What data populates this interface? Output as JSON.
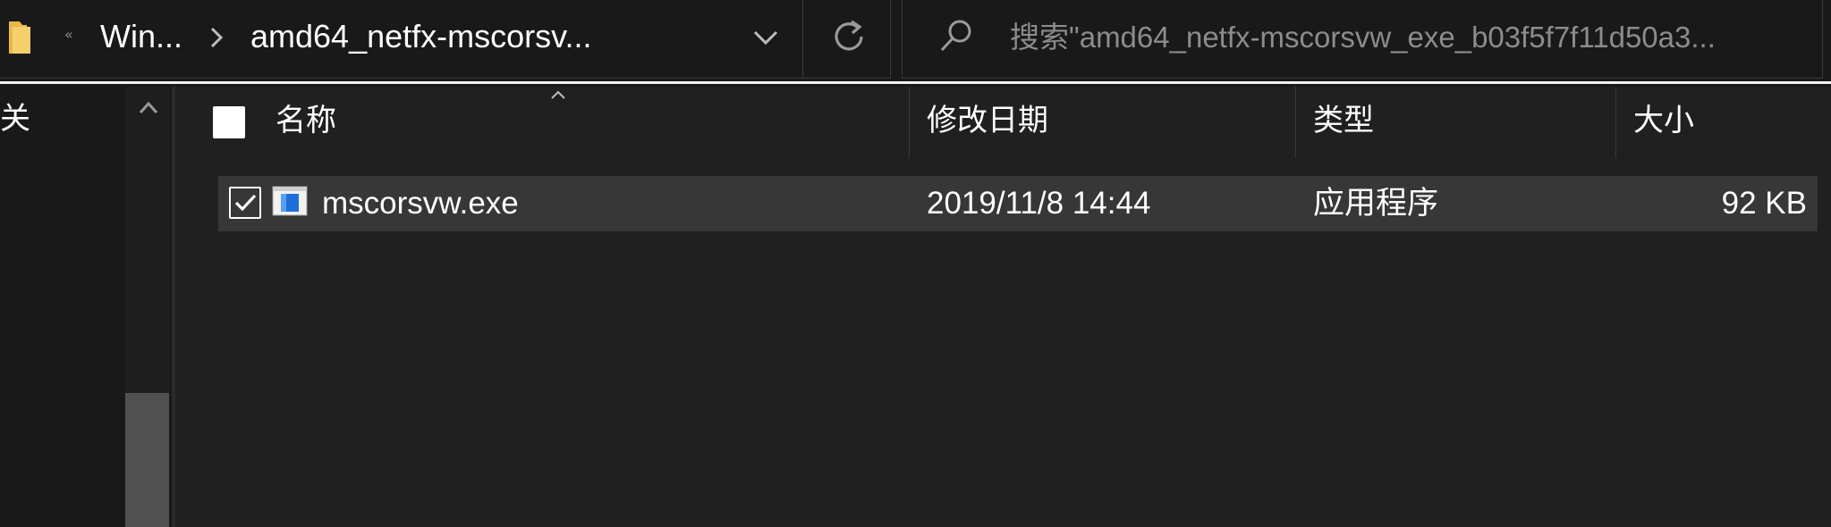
{
  "address_bar": {
    "crumbs": [
      "Win...",
      "amd64_netfx-mscorsv..."
    ],
    "icons": {
      "folder": "folder-icon",
      "back": "double-chevron-left-icon",
      "separator": "chevron-right-icon",
      "dropdown": "chevron-down-icon",
      "refresh": "refresh-icon"
    }
  },
  "search": {
    "placeholder": "搜索\"amd64_netfx-mscorsvw_exe_b03f5f7f11d50a3...",
    "icon": "search-icon"
  },
  "nav_pane": {
    "visible_text": "关",
    "scroll_up_icon": "chevron-up-icon"
  },
  "file_list": {
    "columns": [
      "名称",
      "修改日期",
      "类型",
      "大小"
    ],
    "sorted_column": "名称",
    "rows": [
      {
        "name": "mscorsvw.exe",
        "modified": "2019/11/8 14:44",
        "type": "应用程序",
        "size": "92 KB",
        "selected": true,
        "icon": "application-exe-icon"
      }
    ]
  },
  "colors": {
    "background": "#191919",
    "list_background": "#202020",
    "selected_row": "#373737",
    "text": "#ffffff",
    "muted_text": "#8c8c8c",
    "folder": "#e8b84a",
    "app_icon_blue": "#1e6fd9"
  }
}
